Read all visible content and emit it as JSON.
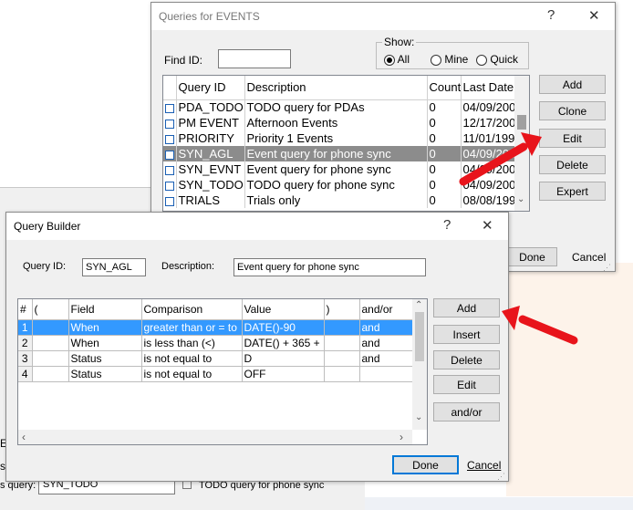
{
  "background_window": {
    "query_label": "s query:",
    "query_value": "SYN_TODO",
    "query_desc": "TODO query for phone sync",
    "side_letter": "E",
    "side_letter2": "s"
  },
  "queries_dialog": {
    "title": "Queries for EVENTS",
    "help_glyph": "?",
    "close_glyph": "✕",
    "find_label": "Find ID:",
    "find_value": "",
    "show_label": "Show:",
    "show_options": [
      "All",
      "Mine",
      "Quick"
    ],
    "show_selected": "All",
    "columns": [
      "Query ID",
      "Description",
      "Count",
      "Last Date"
    ],
    "rows": [
      {
        "id": "PDA_TODO",
        "desc": "TODO query for PDAs",
        "count": "0",
        "date": "04/09/200"
      },
      {
        "id": "PM EVENT",
        "desc": "Afternoon Events",
        "count": "0",
        "date": "12/17/200"
      },
      {
        "id": "PRIORITY",
        "desc": "Priority 1 Events",
        "count": "0",
        "date": "11/01/199"
      },
      {
        "id": "SYN_AGL",
        "desc": "Event query for phone sync",
        "count": "0",
        "date": "04/09/200",
        "selected": true
      },
      {
        "id": "SYN_EVNT",
        "desc": "Event query for phone sync",
        "count": "0",
        "date": "04/09/200"
      },
      {
        "id": "SYN_TODO",
        "desc": "TODO query for phone sync",
        "count": "0",
        "date": "04/09/200"
      },
      {
        "id": "TRIALS",
        "desc": "Trials only",
        "count": "0",
        "date": "08/08/199"
      }
    ],
    "buttons": {
      "add": "Add",
      "clone": "Clone",
      "edit": "Edit",
      "delete": "Delete",
      "expert": "Expert"
    },
    "done": "Done",
    "cancel": "Cancel"
  },
  "query_builder": {
    "title": "Query Builder",
    "help_glyph": "?",
    "close_glyph": "✕",
    "query_id_label": "Query ID:",
    "query_id_value": "SYN_AGL",
    "description_label": "Description:",
    "description_value": "Event query for phone sync",
    "columns": [
      "#",
      "(",
      "Field",
      "Comparison",
      "Value",
      ")",
      "and/or"
    ],
    "rows": [
      {
        "num": "1",
        "open": "",
        "field": "When",
        "comparison": "greater than or = to",
        "value": "DATE()-90",
        "close": "",
        "andor": "and",
        "selected": true
      },
      {
        "num": "2",
        "open": "",
        "field": "When",
        "comparison": "is less than    (<)",
        "value": "DATE() + 365 +",
        "close": "",
        "andor": "and"
      },
      {
        "num": "3",
        "open": "",
        "field": "Status",
        "comparison": "is not equal to",
        "value": "D",
        "close": "",
        "andor": "and"
      },
      {
        "num": "4",
        "open": "",
        "field": "Status",
        "comparison": "is not equal to",
        "value": "OFF",
        "close": "",
        "andor": ""
      }
    ],
    "buttons": {
      "add": "Add",
      "insert": "Insert",
      "delete": "Delete",
      "edit": "Edit",
      "andor": "and/or"
    },
    "done": "Done",
    "cancel": "Cancel"
  },
  "colors": {
    "annotation_arrow": "#e8141b",
    "selection_blue": "#3399ff",
    "selection_gray": "#8c8c8c"
  }
}
